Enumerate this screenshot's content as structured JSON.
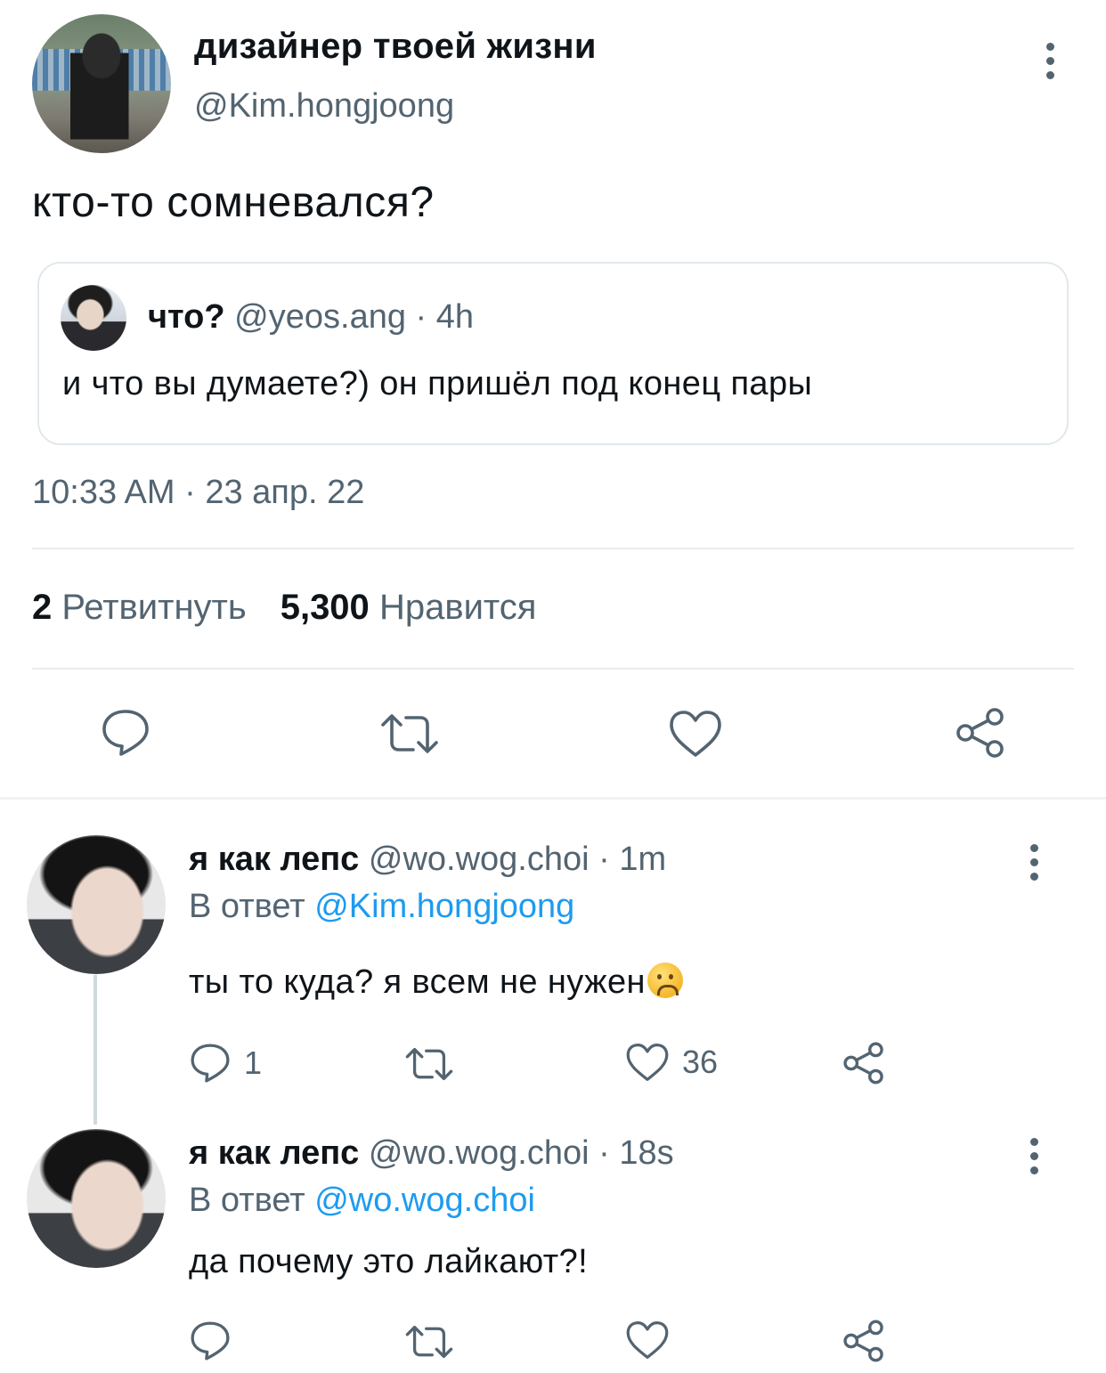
{
  "tweet": {
    "display_name": "дизайнер твоей жизни",
    "handle": "@Kim.hongjoong",
    "text": "кто-то сомневался?",
    "timestamp": "10:33 AM · 23 апр. 22",
    "stats": {
      "retweets_count": "2",
      "retweets_label": "Ретвитнуть",
      "likes_count": "5,300",
      "likes_label": "Нравится"
    }
  },
  "quoted_tweet": {
    "display_name": "что?",
    "handle_time": "@yeos.ang · 4h",
    "text": "и что вы думаете?) он пришёл под конец пары"
  },
  "replies": [
    {
      "display_name": "я как лепс",
      "handle_time": "@wo.wog.choi · 1m",
      "reply_prefix": "В ответ",
      "reply_to": "@Kim.hongjoong",
      "text": "ты то куда? я всем не нужен",
      "emoji": "frowning-face",
      "reply_count": "1",
      "like_count": "36"
    },
    {
      "display_name": "я как лепс",
      "handle_time": "@wo.wog.choi · 18s",
      "reply_prefix": "В ответ",
      "reply_to": "@wo.wog.choi",
      "text": "да почему это лайкают?!"
    }
  ],
  "icons": {
    "reply": "speech-bubble-icon",
    "retweet": "retweet-arrows-icon",
    "like": "heart-icon",
    "share": "share-nodes-icon",
    "more": "vertical-ellipsis-icon"
  },
  "colors": {
    "text": "#0f1419",
    "secondary": "#536471",
    "link": "#1d9bf0",
    "border": "#e1e8ed"
  }
}
